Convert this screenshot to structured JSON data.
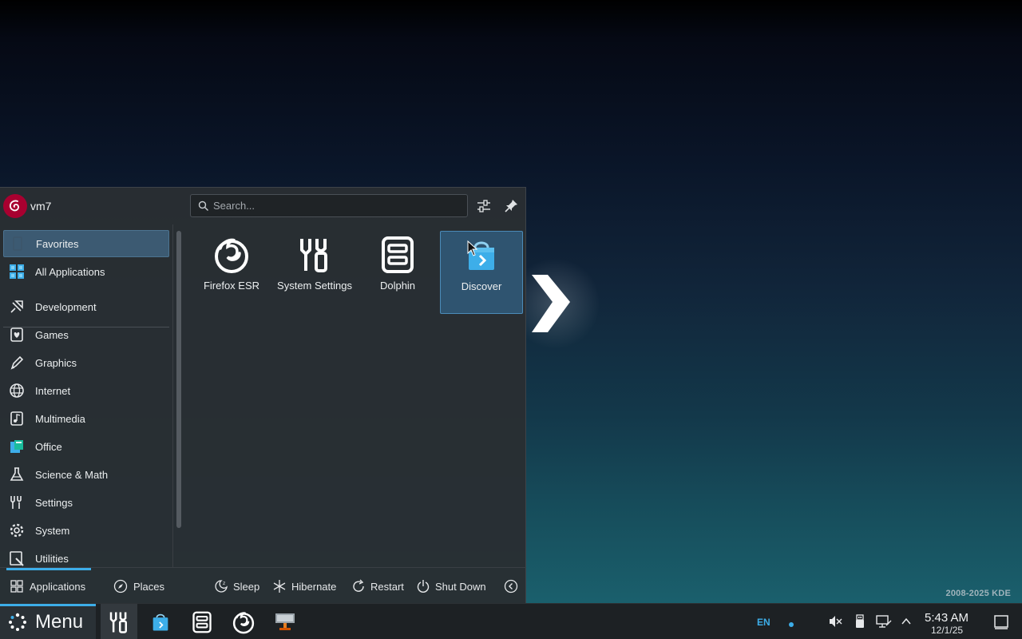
{
  "desktop": {
    "credit": "2008-2025 KDE"
  },
  "launcher": {
    "user": {
      "name": "vm7"
    },
    "search": {
      "placeholder": "Search..."
    },
    "categories": [
      {
        "label": "Favorites",
        "icon": "favorites-icon",
        "active": true
      },
      {
        "label": "All Applications",
        "icon": "all-apps-icon"
      },
      {
        "label": "Development",
        "icon": "development-icon"
      },
      {
        "label": "Games",
        "icon": "games-icon"
      },
      {
        "label": "Graphics",
        "icon": "graphics-icon"
      },
      {
        "label": "Internet",
        "icon": "internet-icon"
      },
      {
        "label": "Multimedia",
        "icon": "multimedia-icon"
      },
      {
        "label": "Office",
        "icon": "office-icon"
      },
      {
        "label": "Science & Math",
        "icon": "science-icon"
      },
      {
        "label": "Settings",
        "icon": "settings-icon"
      },
      {
        "label": "System",
        "icon": "system-icon"
      },
      {
        "label": "Utilities",
        "icon": "utilities-icon"
      }
    ],
    "favorites": [
      {
        "label": "Firefox ESR",
        "icon": "firefox-icon"
      },
      {
        "label": "System Settings",
        "icon": "system-settings-icon"
      },
      {
        "label": "Dolphin",
        "icon": "dolphin-icon"
      },
      {
        "label": "Discover",
        "icon": "discover-icon",
        "hovered": true
      }
    ],
    "footer": {
      "tabs": [
        {
          "label": "Applications",
          "icon": "applications-icon",
          "active": true
        },
        {
          "label": "Places",
          "icon": "places-icon"
        }
      ],
      "power": [
        {
          "label": "Sleep",
          "icon": "sleep-icon"
        },
        {
          "label": "Hibernate",
          "icon": "hibernate-icon"
        },
        {
          "label": "Restart",
          "icon": "restart-icon"
        },
        {
          "label": "Shut Down",
          "icon": "shutdown-icon"
        }
      ]
    }
  },
  "taskbar": {
    "menu_label": "Menu",
    "tasks": [
      "system-settings-icon",
      "discover-icon",
      "dolphin-icon",
      "firefox-icon",
      "screenshot-app-icon"
    ],
    "tray": {
      "language": "EN",
      "icons": [
        "volume-muted-icon",
        "usb-icon",
        "network-icon",
        "tray-expand-icon"
      ]
    },
    "clock": {
      "time": "5:43 AM",
      "date": "12/1/25"
    }
  },
  "colors": {
    "accent": "#3daee9",
    "panel": "#292e33",
    "selection": "#3c5a72"
  }
}
